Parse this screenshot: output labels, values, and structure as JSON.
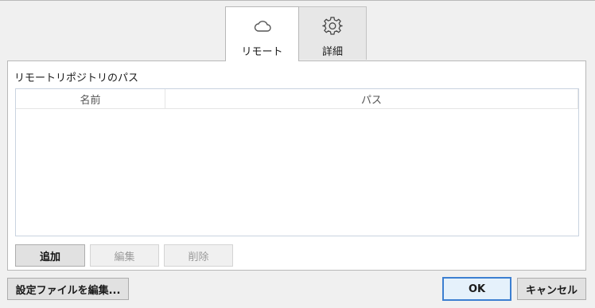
{
  "tabs": [
    {
      "label": "リモート",
      "icon": "cloud-icon",
      "active": true
    },
    {
      "label": "詳細",
      "icon": "gear-icon",
      "active": false
    }
  ],
  "remote": {
    "section_label": "リモートリポジトリのパス",
    "columns": [
      "名前",
      "パス"
    ],
    "rows": [],
    "buttons": {
      "add": "追加",
      "edit": "編集",
      "delete": "削除"
    }
  },
  "footer": {
    "edit_settings_file": "設定ファイルを編集...",
    "ok": "OK",
    "cancel": "キャンセル"
  },
  "colors": {
    "accent": "#3c7fd1",
    "panel_bg": "#ffffff",
    "window_bg": "#f0f0f0"
  }
}
